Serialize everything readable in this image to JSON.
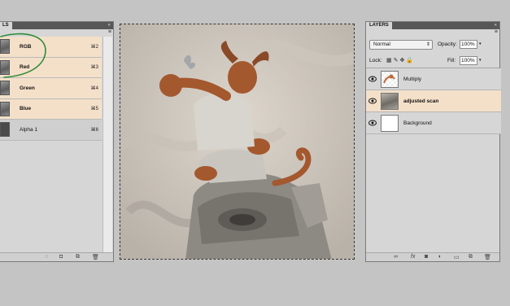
{
  "channels_panel": {
    "tab_label": "LS",
    "close_glyph": "«",
    "menu_glyph": "≡",
    "channels": [
      {
        "name": "RGB",
        "shortcut": "⌘2",
        "state": "active"
      },
      {
        "name": "Red",
        "shortcut": "⌘3",
        "state": "active"
      },
      {
        "name": "Green",
        "shortcut": "⌘4",
        "state": "active"
      },
      {
        "name": "Blue",
        "shortcut": "⌘5",
        "state": "active"
      },
      {
        "name": "Alpha 1",
        "shortcut": "⌘6",
        "state": "inactive"
      }
    ],
    "footer_icons": [
      "load-selection-icon",
      "save-selection-icon",
      "new-channel-icon",
      "delete-channel-icon"
    ]
  },
  "layers_panel": {
    "tab_label": "LAYERS",
    "close_glyph": "«",
    "menu_glyph": "≡",
    "blend_mode": "Normal",
    "opacity_label": "Opacity:",
    "opacity_value": "100%",
    "lock_label": "Lock:",
    "fill_label": "Fill:",
    "fill_value": "100%",
    "layers": [
      {
        "name": "Multiply",
        "selected": false,
        "visible": true
      },
      {
        "name": "adjusted scan",
        "selected": true,
        "visible": true
      },
      {
        "name": "Background",
        "selected": false,
        "visible": true
      }
    ],
    "footer_icons": [
      "link-icon",
      "fx-icon",
      "mask-icon",
      "adjustment-icon",
      "group-icon",
      "new-layer-icon",
      "trash-icon"
    ]
  },
  "colors": {
    "selected_row": "#f4e0c9",
    "panel_bg": "#d6d6d6",
    "annotation_circle": "#2e8b3a",
    "character_skin": "#a4582e"
  }
}
